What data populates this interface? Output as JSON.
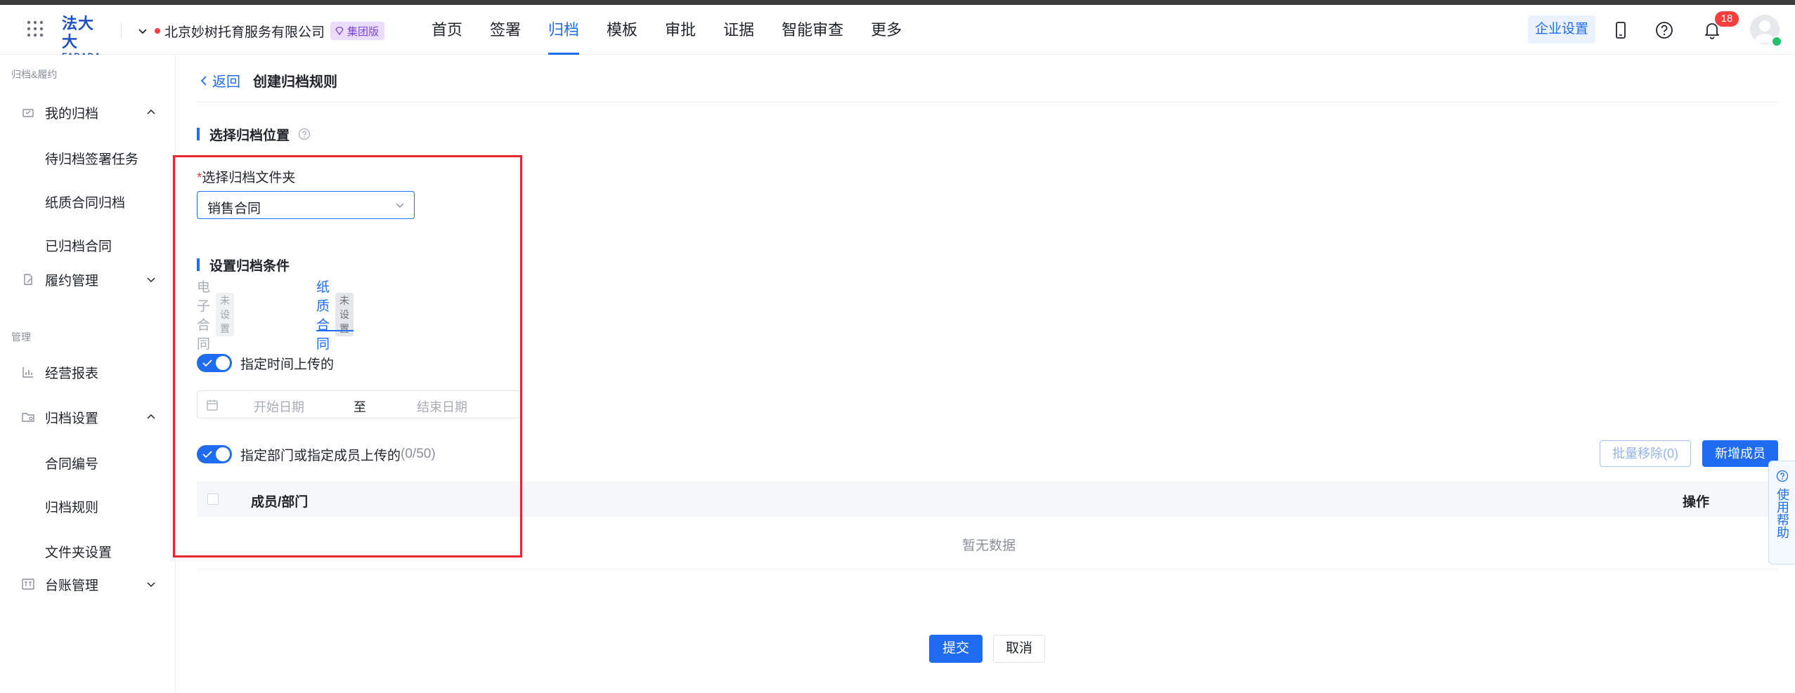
{
  "header": {
    "logo_line1": "法大大",
    "logo_line2": "FADADA",
    "org_name": "北京妙树托育服务有限公司",
    "org_badge": "集团版",
    "nav": [
      "首页",
      "签署",
      "归档",
      "模板",
      "审批",
      "证据",
      "智能审查",
      "更多"
    ],
    "active_nav": "归档",
    "enterprise_settings": "企业设置",
    "notification_count": "18"
  },
  "sidebar": {
    "section1": "归档&履约",
    "my_archive": "我的归档",
    "my_archive_sub": [
      "待归档签署任务",
      "纸质合同归档",
      "已归档合同"
    ],
    "performance": "履约管理",
    "section2": "管理",
    "reports": "经营报表",
    "archive_settings": "归档设置",
    "archive_settings_sub": [
      "合同编号",
      "归档规则",
      "文件夹设置"
    ],
    "ledger": "台账管理"
  },
  "main": {
    "back": "返回",
    "title": "创建归档规则",
    "section_location": "选择归档位置",
    "folder_label_req": "*",
    "folder_label": "选择归档文件夹",
    "folder_value": "销售合同",
    "section_conditions": "设置归档条件",
    "tabs": [
      {
        "label": "电子合同",
        "tag": "未设置"
      },
      {
        "label": "纸质合同",
        "tag": "未设置"
      }
    ],
    "toggle_time": "指定时间上传的",
    "date_start": "开始日期",
    "date_to": "至",
    "date_end": "结束日期",
    "toggle_members": "指定部门或指定成员上传的",
    "members_count": "(0/50)",
    "batch_remove": "批量移除(0)",
    "add_member": "新增成员",
    "col_member": "成员/部门",
    "col_action": "操作",
    "empty": "暂无数据",
    "submit": "提交",
    "cancel": "取消"
  },
  "help": "使用帮助",
  "colors": {
    "primary": "#1f6cf0",
    "highlight": "#e8262b",
    "badge": "#e9dcff"
  }
}
